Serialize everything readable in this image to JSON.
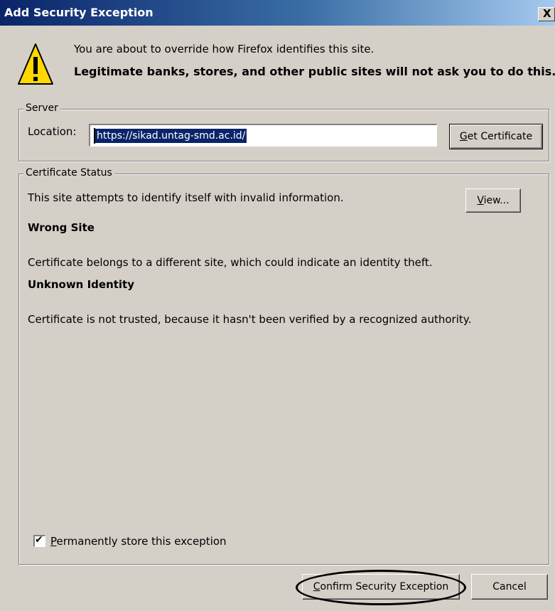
{
  "window": {
    "title": "Add Security Exception",
    "close_glyph": "X"
  },
  "intro": {
    "icon": "warning-icon",
    "line1": "You are about to override how Firefox identifies this site.",
    "line2": "Legitimate banks, stores, and other public sites will not ask you to do this."
  },
  "server": {
    "legend": "Server",
    "location_label": "Location:",
    "location_value": "https://sikad.untag-smd.ac.id/",
    "get_certificate": {
      "label_mnemonic": "G",
      "label_rest": "et Certificate"
    }
  },
  "status": {
    "legend": "Certificate Status",
    "summary": "This site attempts to identify itself with invalid information.",
    "view_button": {
      "label_mnemonic": "V",
      "label_rest": "iew..."
    },
    "issues": [
      {
        "title": "Wrong Site",
        "description": "Certificate belongs to a different site, which could indicate an identity theft."
      },
      {
        "title": "Unknown Identity",
        "description": "Certificate is not trusted, because it hasn't been verified by a recognized authority."
      }
    ],
    "permanent": {
      "checked": true,
      "check_glyph": "✔",
      "label_mnemonic": "P",
      "label_rest": "ermanently store this exception"
    }
  },
  "footer": {
    "confirm": {
      "label_mnemonic": "C",
      "label_rest": "onfirm Security Exception"
    },
    "cancel_label": "Cancel"
  },
  "colors": {
    "dialog_bg": "#d4d0c8",
    "title_bar_start": "#0a246a",
    "title_bar_end": "#a6caf0",
    "selection_bg": "#0a246a",
    "warning_yellow": "#ffd800"
  }
}
